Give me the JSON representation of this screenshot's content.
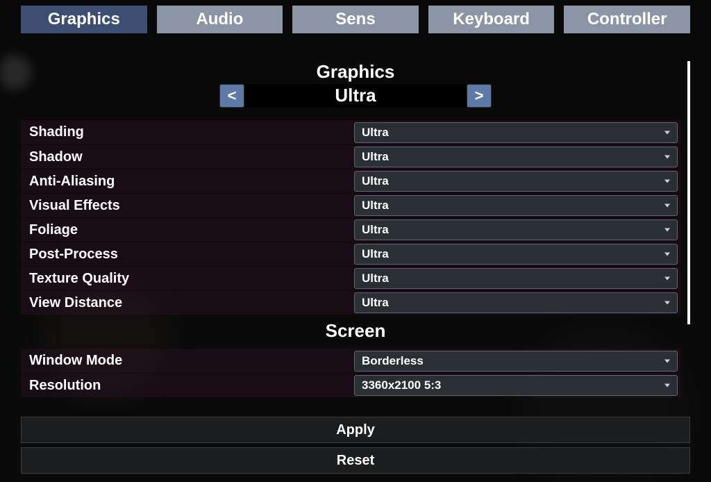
{
  "tabs": {
    "graphics": "Graphics",
    "audio": "Audio",
    "sens": "Sens",
    "keyboard": "Keyboard",
    "controller": "Controller"
  },
  "graphics_section": {
    "title": "Graphics",
    "preset_prev": "<",
    "preset_value": "Ultra",
    "preset_next": ">",
    "rows": {
      "shading": {
        "label": "Shading",
        "value": "Ultra"
      },
      "shadow": {
        "label": "Shadow",
        "value": "Ultra"
      },
      "anti_aliasing": {
        "label": "Anti-Aliasing",
        "value": "Ultra"
      },
      "visual_effects": {
        "label": "Visual Effects",
        "value": "Ultra"
      },
      "foliage": {
        "label": "Foliage",
        "value": "Ultra"
      },
      "post_process": {
        "label": "Post-Process",
        "value": "Ultra"
      },
      "texture_quality": {
        "label": "Texture Quality",
        "value": "Ultra"
      },
      "view_distance": {
        "label": "View Distance",
        "value": "Ultra"
      }
    }
  },
  "screen_section": {
    "title": "Screen",
    "rows": {
      "window_mode": {
        "label": "Window Mode",
        "value": "Borderless"
      },
      "resolution": {
        "label": "Resolution",
        "value": "3360x2100   5:3"
      }
    }
  },
  "buttons": {
    "apply": "Apply",
    "reset": "Reset"
  }
}
